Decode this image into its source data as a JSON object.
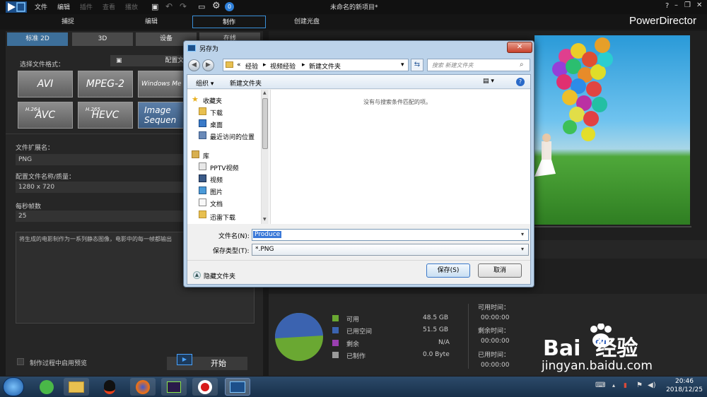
{
  "app": {
    "title": "未命名的新项目*",
    "brand": "PowerDirector",
    "menu": [
      "文件",
      "编辑",
      "插件",
      "查看",
      "播放"
    ],
    "window_controls": [
      "?",
      "–",
      "❐",
      "✕"
    ]
  },
  "modes": [
    "捕捉",
    "编辑",
    "制作",
    "创建光盘"
  ],
  "subtabs": [
    "标准 2D",
    "3D",
    "设备",
    "在线"
  ],
  "left": {
    "format_label": "选择文件格式：",
    "profile_btn": "配置文",
    "formats": [
      {
        "top": "",
        "main": "AVI"
      },
      {
        "top": "",
        "main": "MPEG-2"
      },
      {
        "top": "",
        "main": "Windows Me"
      },
      {
        "top": "H.264",
        "main": "AVC"
      },
      {
        "top": "H.265",
        "main": "HEVC"
      },
      {
        "top": "",
        "main": "Image Sequen"
      }
    ],
    "ext_label": "文件扩展名：",
    "ext_value": "PNG",
    "profile_label": "配置文件名称/质量：",
    "profile_value": "1280 x 720",
    "fps_label": "每秒帧数",
    "fps_value": "25",
    "desc": "将生成的电影制作为一系列静态图像，电影中的每一帧都输出",
    "preview_label": "制作过程中启用预览",
    "start_btn": "开始"
  },
  "storage": {
    "legend": [
      {
        "label": "可用",
        "value": "48.5  GB",
        "color": "#6aa832"
      },
      {
        "label": "已用空间",
        "value": "51.5  GB",
        "color": "#3b63b0"
      },
      {
        "label": "剩余",
        "value": "N/A",
        "color": "#9a3fb0"
      },
      {
        "label": "已制作",
        "value": "0.0   Byte",
        "color": "#9a9a9a"
      }
    ],
    "pie_used_fraction": 0.515,
    "times": [
      {
        "label": "可用时间：",
        "value": "00:00:00"
      },
      {
        "label": "剩余时间：",
        "value": "00:00:00"
      },
      {
        "label": "已用时间：",
        "value": "00:00:00"
      }
    ]
  },
  "dialog": {
    "title": "另存为",
    "breadcrumb": [
      "«",
      "经验",
      "视频经验",
      "新建文件夹"
    ],
    "search_placeholder": "搜索 新建文件夹",
    "organize": "组织 ▾",
    "new_folder": "新建文件夹",
    "empty_msg": "没有与搜索条件匹配的项。",
    "nav": [
      {
        "label": "收藏夹",
        "icon": "star-icon",
        "indent": 0
      },
      {
        "label": "下载",
        "icon": "download-folder-icon",
        "indent": 1
      },
      {
        "label": "桌面",
        "icon": "desktop-icon",
        "indent": 1
      },
      {
        "label": "最近访问的位置",
        "icon": "recent-places-icon",
        "indent": 1
      },
      {
        "label": "库",
        "icon": "library-icon",
        "indent": 0
      },
      {
        "label": "PPTV视频",
        "icon": "video-folder-icon",
        "indent": 1
      },
      {
        "label": "视频",
        "icon": "video-folder-icon",
        "indent": 1
      },
      {
        "label": "图片",
        "icon": "picture-folder-icon",
        "indent": 1
      },
      {
        "label": "文档",
        "icon": "document-folder-icon",
        "indent": 1
      },
      {
        "label": "迅雷下载",
        "icon": "folder-icon",
        "indent": 1
      }
    ],
    "filename_label": "文件名(N):",
    "filename_value": "Produce",
    "filetype_label": "保存类型(T):",
    "filetype_value": "*.PNG",
    "hide_folders": "隐藏文件夹",
    "save": "保存(S)",
    "cancel": "取消"
  },
  "taskbar": {
    "time": "20:46",
    "date": "2018/12/25"
  },
  "watermark": {
    "brand": "Bai  经验",
    "url": "jingyan.baidu.com"
  }
}
